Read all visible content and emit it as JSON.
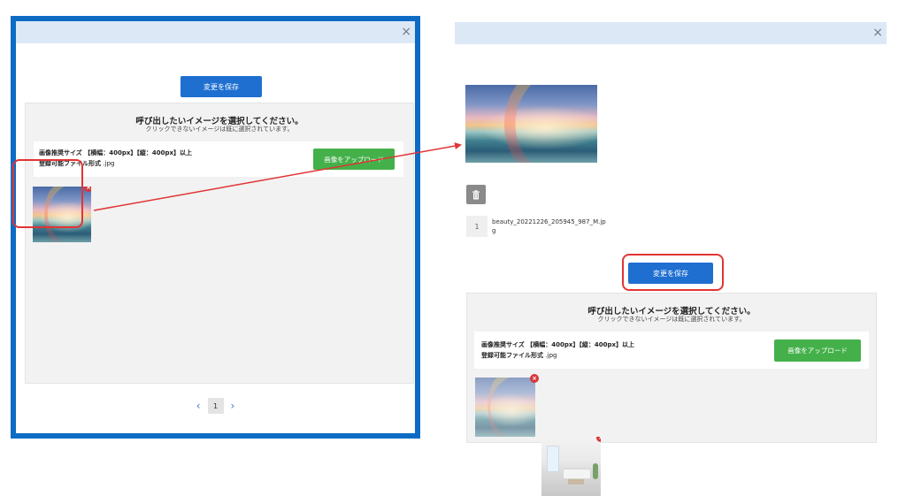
{
  "left_dialog": {
    "close": "×",
    "save_label": "変更を保存",
    "title": "呼び出したいイメージを選択してください。",
    "subtitle": "クリックできないイメージは既に選択されています。",
    "size_label": "画像推奨サイズ 【横幅：400px】【縦：400px】以上",
    "format_label": "登録可能ファイル形式",
    "format_value": ".jpg",
    "upload_label": "画像をアップロード",
    "remove_symbol": "×",
    "pager": {
      "prev": "‹",
      "page": "1",
      "next": "›"
    }
  },
  "right_dialog": {
    "close": "×",
    "file_index": "1",
    "file_name": "beauty_20221226_205945_987_M.jpg",
    "save_label": "変更を保存",
    "title": "呼び出したいイメージを選択してください。",
    "subtitle": "クリックできないイメージは既に選択されています。",
    "size_label": "画像推奨サイズ 【横幅：400px】【縦：400px】以上",
    "format_label": "登録可能ファイル形式",
    "format_value": ".jpg",
    "upload_label": "画像をアップロード",
    "remove_symbol": "×"
  },
  "colors": {
    "header_bg": "#dde8f7",
    "frame_blue": "#0c6cc4",
    "save_blue": "#1f6fd1",
    "upload_green": "#44b04a",
    "highlight_red": "#e23434",
    "remove_red": "#d9353a"
  },
  "icons": {
    "trash": "trash-icon",
    "close": "close-icon",
    "remove": "remove-circle-icon",
    "chevrons": [
      "chevron-left-icon",
      "chevron-right-icon"
    ]
  }
}
